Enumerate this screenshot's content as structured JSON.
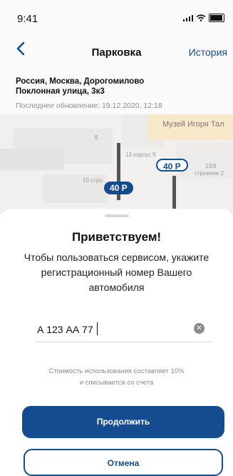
{
  "status_bar": {
    "time": "9:41"
  },
  "header": {
    "title": "Парковка",
    "history_label": "История"
  },
  "location": {
    "line1": "Россия, Москва, Дорогомилово",
    "line2": "Поклонная улица, 3к3",
    "updated": "Последнее обновление: 19.12.2020, 12:18"
  },
  "map": {
    "museum_label": "Музей Игоря Тал",
    "labels": [
      "8",
      "13 корпус 9",
      "13/9",
      "строение 2",
      "10 стро"
    ],
    "price_outline": "40 Р",
    "price_filled": "40 Р"
  },
  "sheet": {
    "title": "Приветствуем!",
    "text_line1": "Чтобы пользоваться сервисом, укажите",
    "text_line2": "регистрационный номер Вашего",
    "text_line3": "автомобиля",
    "plate_value": "А 123 АА 77",
    "note_line1": "Стоимость использования составляет 10%",
    "note_line2": "и списывается со счета",
    "continue_label": "Продолжить",
    "cancel_label": "Отмена"
  },
  "colors": {
    "accent": "#154c8f",
    "muted": "#8a8a8a"
  }
}
